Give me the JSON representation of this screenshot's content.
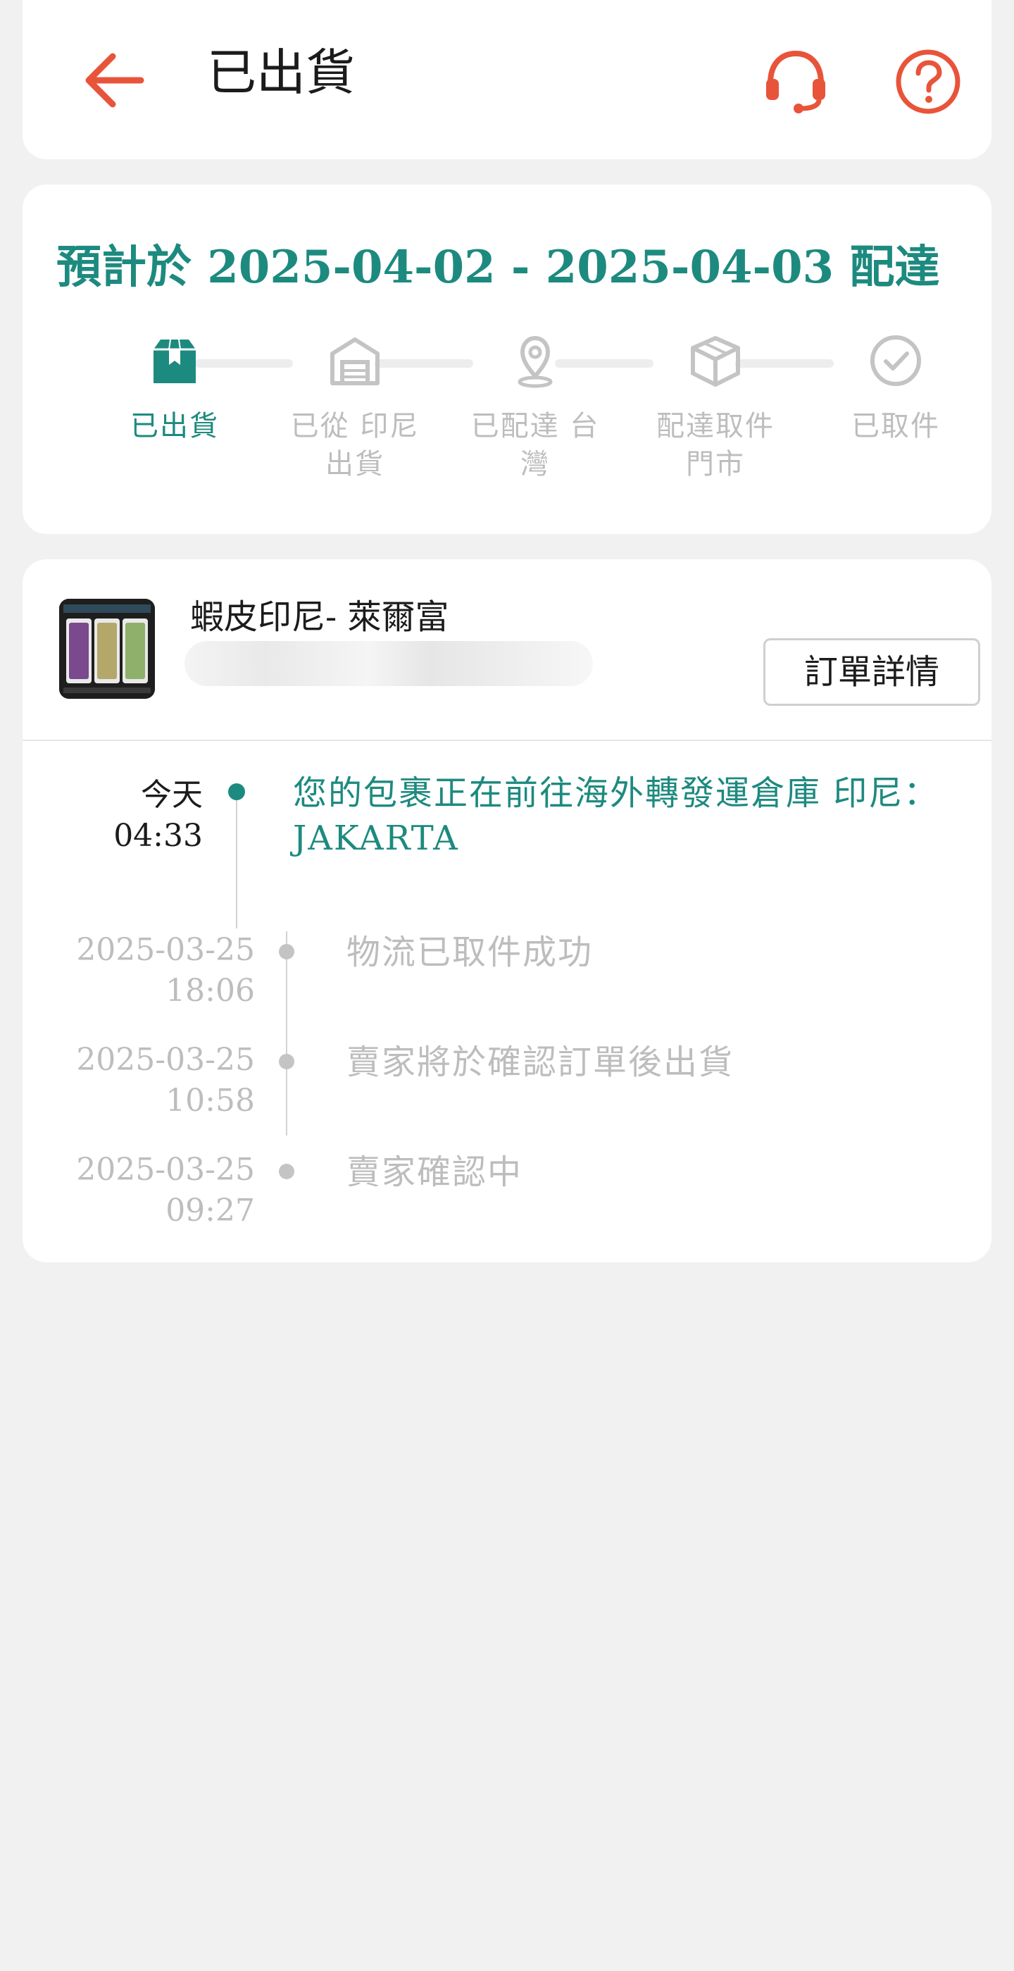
{
  "header": {
    "title": "已出貨",
    "back_icon": "arrow-left-icon",
    "support_icon": "headset-icon",
    "help_icon": "question-circle-icon",
    "accent_color": "#e8543a"
  },
  "delivery": {
    "eta": "預計於 2025-04-02 - 2025-04-03 配達",
    "accent_color": "#1d8a7f",
    "steps": [
      {
        "label_line1": "已出貨",
        "label_line2": "",
        "icon": "package-icon",
        "active": true
      },
      {
        "label_line1": "已從 印尼",
        "label_line2": "出貨",
        "icon": "warehouse-icon",
        "active": false
      },
      {
        "label_line1": "已配達 台",
        "label_line2": "灣",
        "icon": "map-pin-icon",
        "active": false
      },
      {
        "label_line1": "配達取件",
        "label_line2": "門市",
        "icon": "box-icon",
        "active": false
      },
      {
        "label_line1": "已取件",
        "label_line2": "",
        "icon": "check-circle-icon",
        "active": false
      }
    ]
  },
  "order": {
    "shop_name": "蝦皮印尼- 萊爾富",
    "details_button": "訂單詳情"
  },
  "timeline": [
    {
      "time_line1": "今天",
      "time_line2": "04:33",
      "text": "您的包裹正在前往海外轉發運倉庫 印尼：JAKARTA",
      "active": true
    },
    {
      "time_line1": "2025-03-25",
      "time_line2": "18:06",
      "text": "物流已取件成功",
      "active": false
    },
    {
      "time_line1": "2025-03-25",
      "time_line2": "10:58",
      "text": "賣家將於確認訂單後出貨",
      "active": false
    },
    {
      "time_line1": "2025-03-25",
      "time_line2": "09:27",
      "text": "賣家確認中",
      "active": false
    }
  ]
}
